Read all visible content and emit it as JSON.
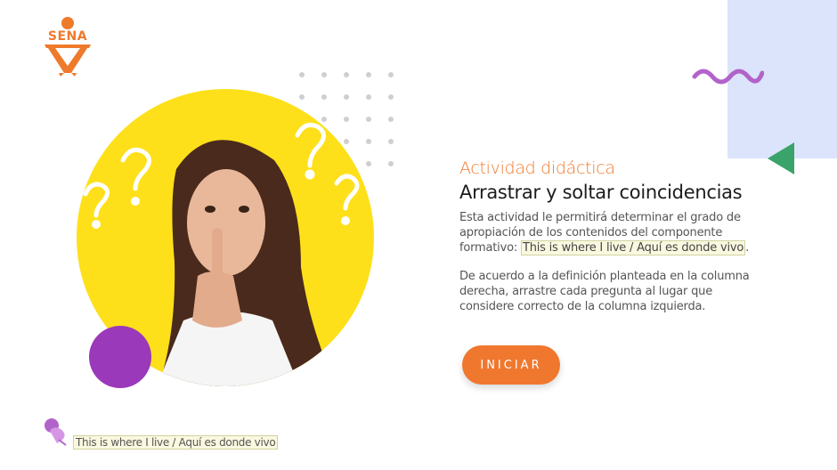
{
  "logo": {
    "text": "SENA",
    "color": "#ee7a2c"
  },
  "activity": {
    "eyebrow": "Actividad didáctica",
    "title": "Arrastrar y soltar coincidencias",
    "description": "Esta actividad le permitirá determinar el grado de apropiación de los contenidos del componente formativo:",
    "component_name": "This is where I live / Aquí es donde vivo",
    "component_suffix": ".",
    "instructions": "De acuerdo a la definición planteada en la columna derecha, arrastre cada pregunta al lugar que considere correcto de la columna izquierda."
  },
  "start_button": {
    "label": "INICIAR"
  },
  "footer": {
    "label": "This is where I live / Aquí es donde vivo"
  },
  "colors": {
    "accent": "#ee7a2c",
    "yellow": "#fde01a",
    "purple": "#9a39b9",
    "green": "#3aa36a",
    "blue_panel": "#dbe4fb"
  }
}
